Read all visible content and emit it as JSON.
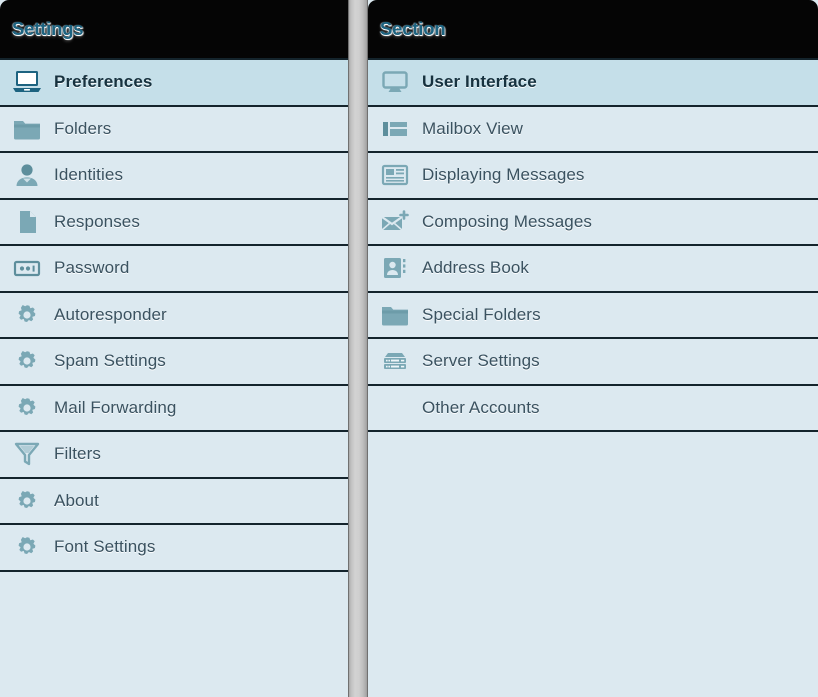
{
  "window": {
    "background_color": "#c9c9c9",
    "panel_background": "#dce9f0",
    "selected_background": "#c5dfe9",
    "header_background": "#050505",
    "title_color": "#1d6380",
    "icon_color": "#79a7b4",
    "label_color": "#3a5260",
    "separator_color": "#14242c"
  },
  "settings_panel": {
    "title": "Settings",
    "items": [
      {
        "label": "Preferences",
        "icon": "laptop-icon",
        "selected": true
      },
      {
        "label": "Folders",
        "icon": "folder-icon",
        "selected": false
      },
      {
        "label": "Identities",
        "icon": "user-icon",
        "selected": false
      },
      {
        "label": "Responses",
        "icon": "document-icon",
        "selected": false
      },
      {
        "label": "Password",
        "icon": "password-card-icon",
        "selected": false
      },
      {
        "label": "Autoresponder",
        "icon": "gear-icon",
        "selected": false
      },
      {
        "label": "Spam Settings",
        "icon": "gear-icon",
        "selected": false
      },
      {
        "label": "Mail Forwarding",
        "icon": "gear-icon",
        "selected": false
      },
      {
        "label": "Filters",
        "icon": "funnel-icon",
        "selected": false
      },
      {
        "label": "About",
        "icon": "gear-icon",
        "selected": false
      },
      {
        "label": "Font Settings",
        "icon": "gear-icon",
        "selected": false
      }
    ]
  },
  "section_panel": {
    "title": "Section",
    "items": [
      {
        "label": "User Interface",
        "icon": "monitor-icon",
        "selected": true
      },
      {
        "label": "Mailbox View",
        "icon": "layout-icon",
        "selected": false
      },
      {
        "label": "Displaying Messages",
        "icon": "message-list-icon",
        "selected": false
      },
      {
        "label": "Composing Messages",
        "icon": "envelope-plus-icon",
        "selected": false
      },
      {
        "label": "Address Book",
        "icon": "address-book-icon",
        "selected": false
      },
      {
        "label": "Special Folders",
        "icon": "folder-icon",
        "selected": false
      },
      {
        "label": "Server Settings",
        "icon": "server-icon",
        "selected": false
      },
      {
        "label": "Other Accounts",
        "icon": "none",
        "selected": false
      }
    ]
  },
  "splitter": {
    "name": "panel-splitter"
  }
}
